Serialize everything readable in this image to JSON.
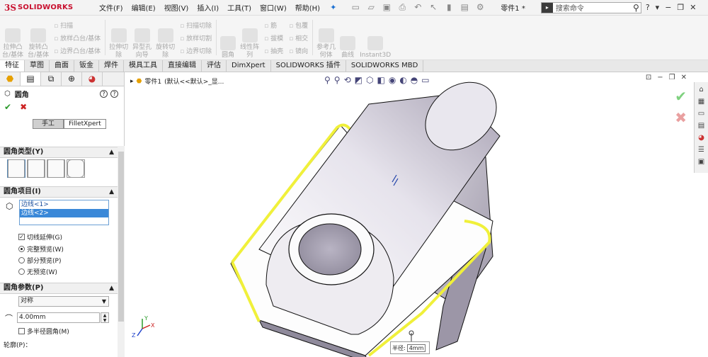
{
  "app": {
    "logo_ds": "3S",
    "logo_text": "SOLIDWORKS"
  },
  "menu": [
    "文件(F)",
    "编辑(E)",
    "视图(V)",
    "插入(I)",
    "工具(T)",
    "窗口(W)",
    "帮助(H)"
  ],
  "doc_title": "零件1 *",
  "search": {
    "placeholder": "搜索命令"
  },
  "ribbon": {
    "big": [
      {
        "label": "拉伸凸\n台/基体"
      },
      {
        "label": "旋转凸\n台/基体"
      }
    ],
    "col1": [
      "扫描",
      "放样凸台/基体",
      "边界凸台/基体"
    ],
    "big2": [
      {
        "label": "拉伸切\n除"
      },
      {
        "label": "异型孔\n向导"
      },
      {
        "label": "旋转切\n除"
      }
    ],
    "col2": [
      "扫描切除",
      "放样切割",
      "边界切除"
    ],
    "big3": [
      {
        "label": "圆角"
      },
      {
        "label": "线性阵\n列"
      }
    ],
    "col3": [
      "筋",
      "拔模",
      "抽壳"
    ],
    "col4": [
      "包覆",
      "相交",
      "镜向"
    ],
    "big4": [
      {
        "label": "参考几\n何体"
      },
      {
        "label": "曲线"
      },
      {
        "label": "Instant3D"
      }
    ]
  },
  "cm_tabs": [
    "特征",
    "草图",
    "曲面",
    "钣金",
    "焊件",
    "模具工具",
    "直接编辑",
    "评估",
    "DimXpert",
    "SOLIDWORKS 插件",
    "SOLIDWORKS MBD"
  ],
  "panel": {
    "title": "圆角",
    "mode_manual": "手工",
    "mode_xpert": "FilletXpert",
    "sec_type": "圆角类型(Y)",
    "sec_items": "圆角项目(I)",
    "items": [
      "边线<1>",
      "边线<2>"
    ],
    "tangent": "切线延伸(G)",
    "preview_full": "完整预览(W)",
    "preview_partial": "部分预览(P)",
    "preview_none": "无预览(W)",
    "sec_params": "圆角参数(P)",
    "symmetric": "对称",
    "radius": "4.00mm",
    "multi_radius": "多半径圆角(M)",
    "profile": "轮廓(P)："
  },
  "tree": {
    "name": "零件1",
    "config": "(默认<<默认>_显..."
  },
  "callout": {
    "label": "半径:",
    "value": "4mm"
  },
  "axes": {
    "x": "X",
    "y": "Y",
    "z": "Z"
  },
  "colors": {
    "highlight": "#f0f03a",
    "accent": "#3a88d8",
    "ok": "#7fd17f",
    "cancel": "#e9a0a0"
  }
}
